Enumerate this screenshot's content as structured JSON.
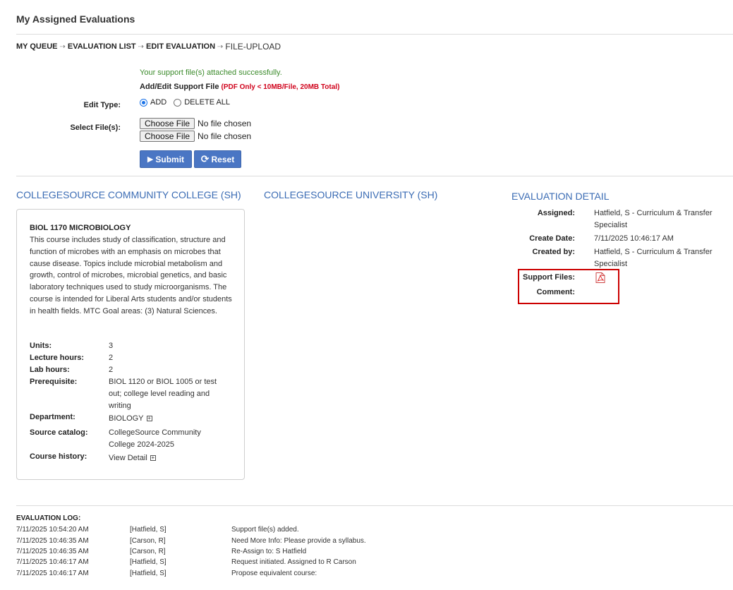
{
  "page": {
    "title": "My Assigned Evaluations"
  },
  "breadcrumb": [
    {
      "label": "MY QUEUE"
    },
    {
      "label": "EVALUATION LIST"
    },
    {
      "label": "EDIT EVALUATION"
    },
    {
      "label": "FILE-UPLOAD"
    }
  ],
  "upload": {
    "success_message": "Your support file(s) attached successfully.",
    "heading": "Add/Edit Support File",
    "limit_note": "(PDF Only < 10MB/File, 20MB Total)",
    "edit_type_label": "Edit Type:",
    "edit_type_options": [
      {
        "label": "ADD",
        "selected": true
      },
      {
        "label": "DELETE ALL",
        "selected": false
      }
    ],
    "select_files_label": "Select File(s):",
    "file_inputs": [
      {
        "button": "Choose File",
        "status": "No file chosen"
      },
      {
        "button": "Choose File",
        "status": "No file chosen"
      }
    ],
    "submit_label": "Submit",
    "reset_label": "Reset",
    "button_color": "#4a76c4"
  },
  "columns": {
    "source_title": "COLLEGESOURCE COMMUNITY COLLEGE (SH)",
    "target_title": "COLLEGESOURCE UNIVERSITY (SH)",
    "detail_title": "EVALUATION DETAIL",
    "title_color": "#3b6cb4"
  },
  "course": {
    "name": "BIOL 1170 MICROBIOLOGY",
    "description": "This course includes study of classification, structure and function of microbes with an emphasis on microbes that cause disease. Topics include microbial metabolism and growth, control of microbes, microbial genetics, and basic laboratory techniques used to study microorganisms. The course is intended for Liberal Arts students and/or students in health fields. MTC Goal areas: (3) Natural Sciences.",
    "fields": {
      "units": {
        "label": "Units:",
        "value": "3"
      },
      "lecture": {
        "label": "Lecture hours:",
        "value": "2"
      },
      "lab": {
        "label": "Lab hours:",
        "value": "2"
      },
      "prereq": {
        "label": "Prerequisite:",
        "value": "BIOL 1120 or BIOL 1005 or test out; college level reading and writing"
      },
      "department": {
        "label": "Department:",
        "value": "BIOLOGY"
      },
      "catalog": {
        "label": "Source catalog:",
        "value": "CollegeSource Community College 2024-2025"
      },
      "history": {
        "label": "Course history:",
        "value": "View Detail"
      }
    }
  },
  "detail": {
    "assigned": {
      "label": "Assigned:",
      "value": "Hatfield, S - Curriculum & Transfer Specialist"
    },
    "create_date": {
      "label": "Create Date:",
      "value": "7/11/2025 10:46:17 AM"
    },
    "created_by": {
      "label": "Created by:",
      "value": "Hatfield, S - Curriculum & Transfer Specialist"
    },
    "support_files": {
      "label": "Support Files:",
      "icon": "pdf-file-icon"
    },
    "comment": {
      "label": "Comment:",
      "value": ""
    },
    "highlight_color": "#cc0000"
  },
  "log": {
    "title": "EVALUATION LOG:",
    "rows": [
      {
        "time": "7/11/2025 10:54:20 AM",
        "user": "[Hatfield, S]",
        "action": "Support file(s) added."
      },
      {
        "time": "7/11/2025 10:46:35 AM",
        "user": "[Carson, R]",
        "action": "Need More Info: Please provide a syllabus."
      },
      {
        "time": "7/11/2025 10:46:35 AM",
        "user": "[Carson, R]",
        "action": "Re-Assign to: S Hatfield"
      },
      {
        "time": "7/11/2025 10:46:17 AM",
        "user": "[Hatfield, S]",
        "action": "Request initiated. Assigned to R Carson"
      },
      {
        "time": "7/11/2025 10:46:17 AM",
        "user": "[Hatfield, S]",
        "action": "Propose equivalent course:"
      }
    ]
  }
}
